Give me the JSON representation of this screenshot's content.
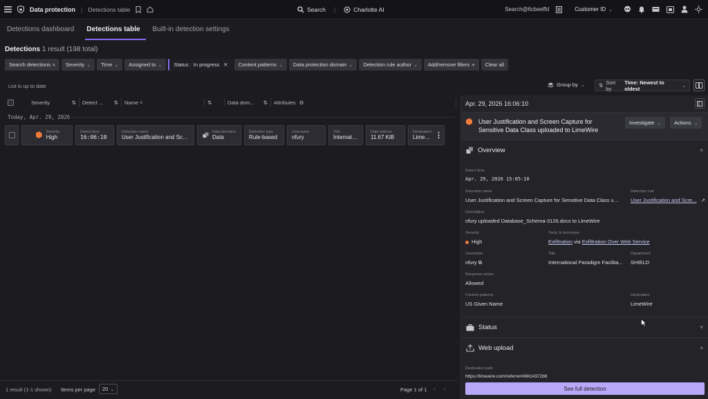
{
  "topbar": {
    "app_title": "Data protection",
    "page": "Detections table",
    "search_label": "Search",
    "assistant_label": "Charlotte AI",
    "search_account": "Search@6cbeeffd",
    "customer_id_label": "Customer ID"
  },
  "tabs": [
    {
      "label": "Detections dashboard"
    },
    {
      "label": "Detections table"
    },
    {
      "label": "Built-in detection settings"
    }
  ],
  "heading": {
    "title": "Detections",
    "count": "1 result (198 total)"
  },
  "filters": {
    "search": "Search detections",
    "severity": "Severity",
    "time": "Time",
    "assigned": "Assigned to",
    "status_key": "Status :",
    "status_value": "In progress",
    "content_patterns": "Content patterns",
    "dp_domain": "Data protection domain",
    "rule_author": "Detection rule author",
    "add_remove": "Add/remove filters",
    "clear": "Clear all"
  },
  "list": {
    "status": "List is up to date",
    "group_by": "Group by",
    "sort_by_label": "Sort by",
    "sort_by_value": "Time: Newest to oldest"
  },
  "table": {
    "headers": {
      "severity": "Severity",
      "detect_time": "Detect ...",
      "name": "Name",
      "data_domain": "Data dom...",
      "attributes": "Attributes"
    },
    "date_group": "Today, Apr. 29, 2026",
    "row": {
      "severity_label": "Severity",
      "severity": "High",
      "detect_time_label": "Detect time",
      "detect_time": "16:06:10",
      "name_label": "Detection name",
      "name": "User Justification and Scree...",
      "domain_label": "Data domains",
      "domain": "Data",
      "type_label": "Detection type",
      "type": "Rule-based",
      "username_label": "Username",
      "username": "nfury",
      "title_label": "Title",
      "title": "Internatio...",
      "volume_label": "Data volume",
      "volume": "11.67 KiB",
      "destination_label": "Destination",
      "destination": "LimeWire"
    }
  },
  "panel": {
    "date": "Apr. 29, 2026 16:06:10",
    "title": "User Justification and Screen Capture for Sensitive Data Class uploaded to LimeWire",
    "investigate": "Investigate",
    "actions": "Actions",
    "overview": "Overview",
    "fields": {
      "detect_time_label": "Detect time",
      "detect_time": "Apr. 29, 2026 15:05:10",
      "detection_name_label": "Detection name",
      "detection_name": "User Justification and Screen Capture for Sensitive Data Class upl...",
      "detection_rule_label": "Detection rule",
      "detection_rule": "User Justification and Scre...",
      "description_label": "Description",
      "description": "nfury uploaded Database_Schema-3126.docx to LimeWire",
      "severity_label": "Severity",
      "severity": "High",
      "tactic_label": "Tactic & technique",
      "tactic": "Exfiltration",
      "via": "via",
      "technique": "Exfiltration Over Web Service",
      "username_label": "Username",
      "username": "nfury",
      "title_label": "Title",
      "title": "International Paradigm Facilita...",
      "department_label": "Department",
      "department": "SHIELD",
      "response_label": "Response action",
      "response": "Allowed",
      "content_label": "Content patterns",
      "content": "US Given Name",
      "destination_label": "Destination",
      "destination": "LimeWire"
    },
    "status_section": "Status",
    "web_upload_section": "Web upload",
    "destination_path_label": "Destination path",
    "destination_path": "https://limewire.com/referrer/49b14372b6",
    "full_detection": "See full detection"
  },
  "footer": {
    "results": "1 result (1-1 shown)",
    "items_per_page": "Items per page",
    "per_page_value": "20",
    "page_info": "Page 1 of 1"
  },
  "colors": {
    "accent": "#8c6cf0",
    "severity_high": "#f07c3c",
    "primary_button": "#b8a8f8"
  }
}
